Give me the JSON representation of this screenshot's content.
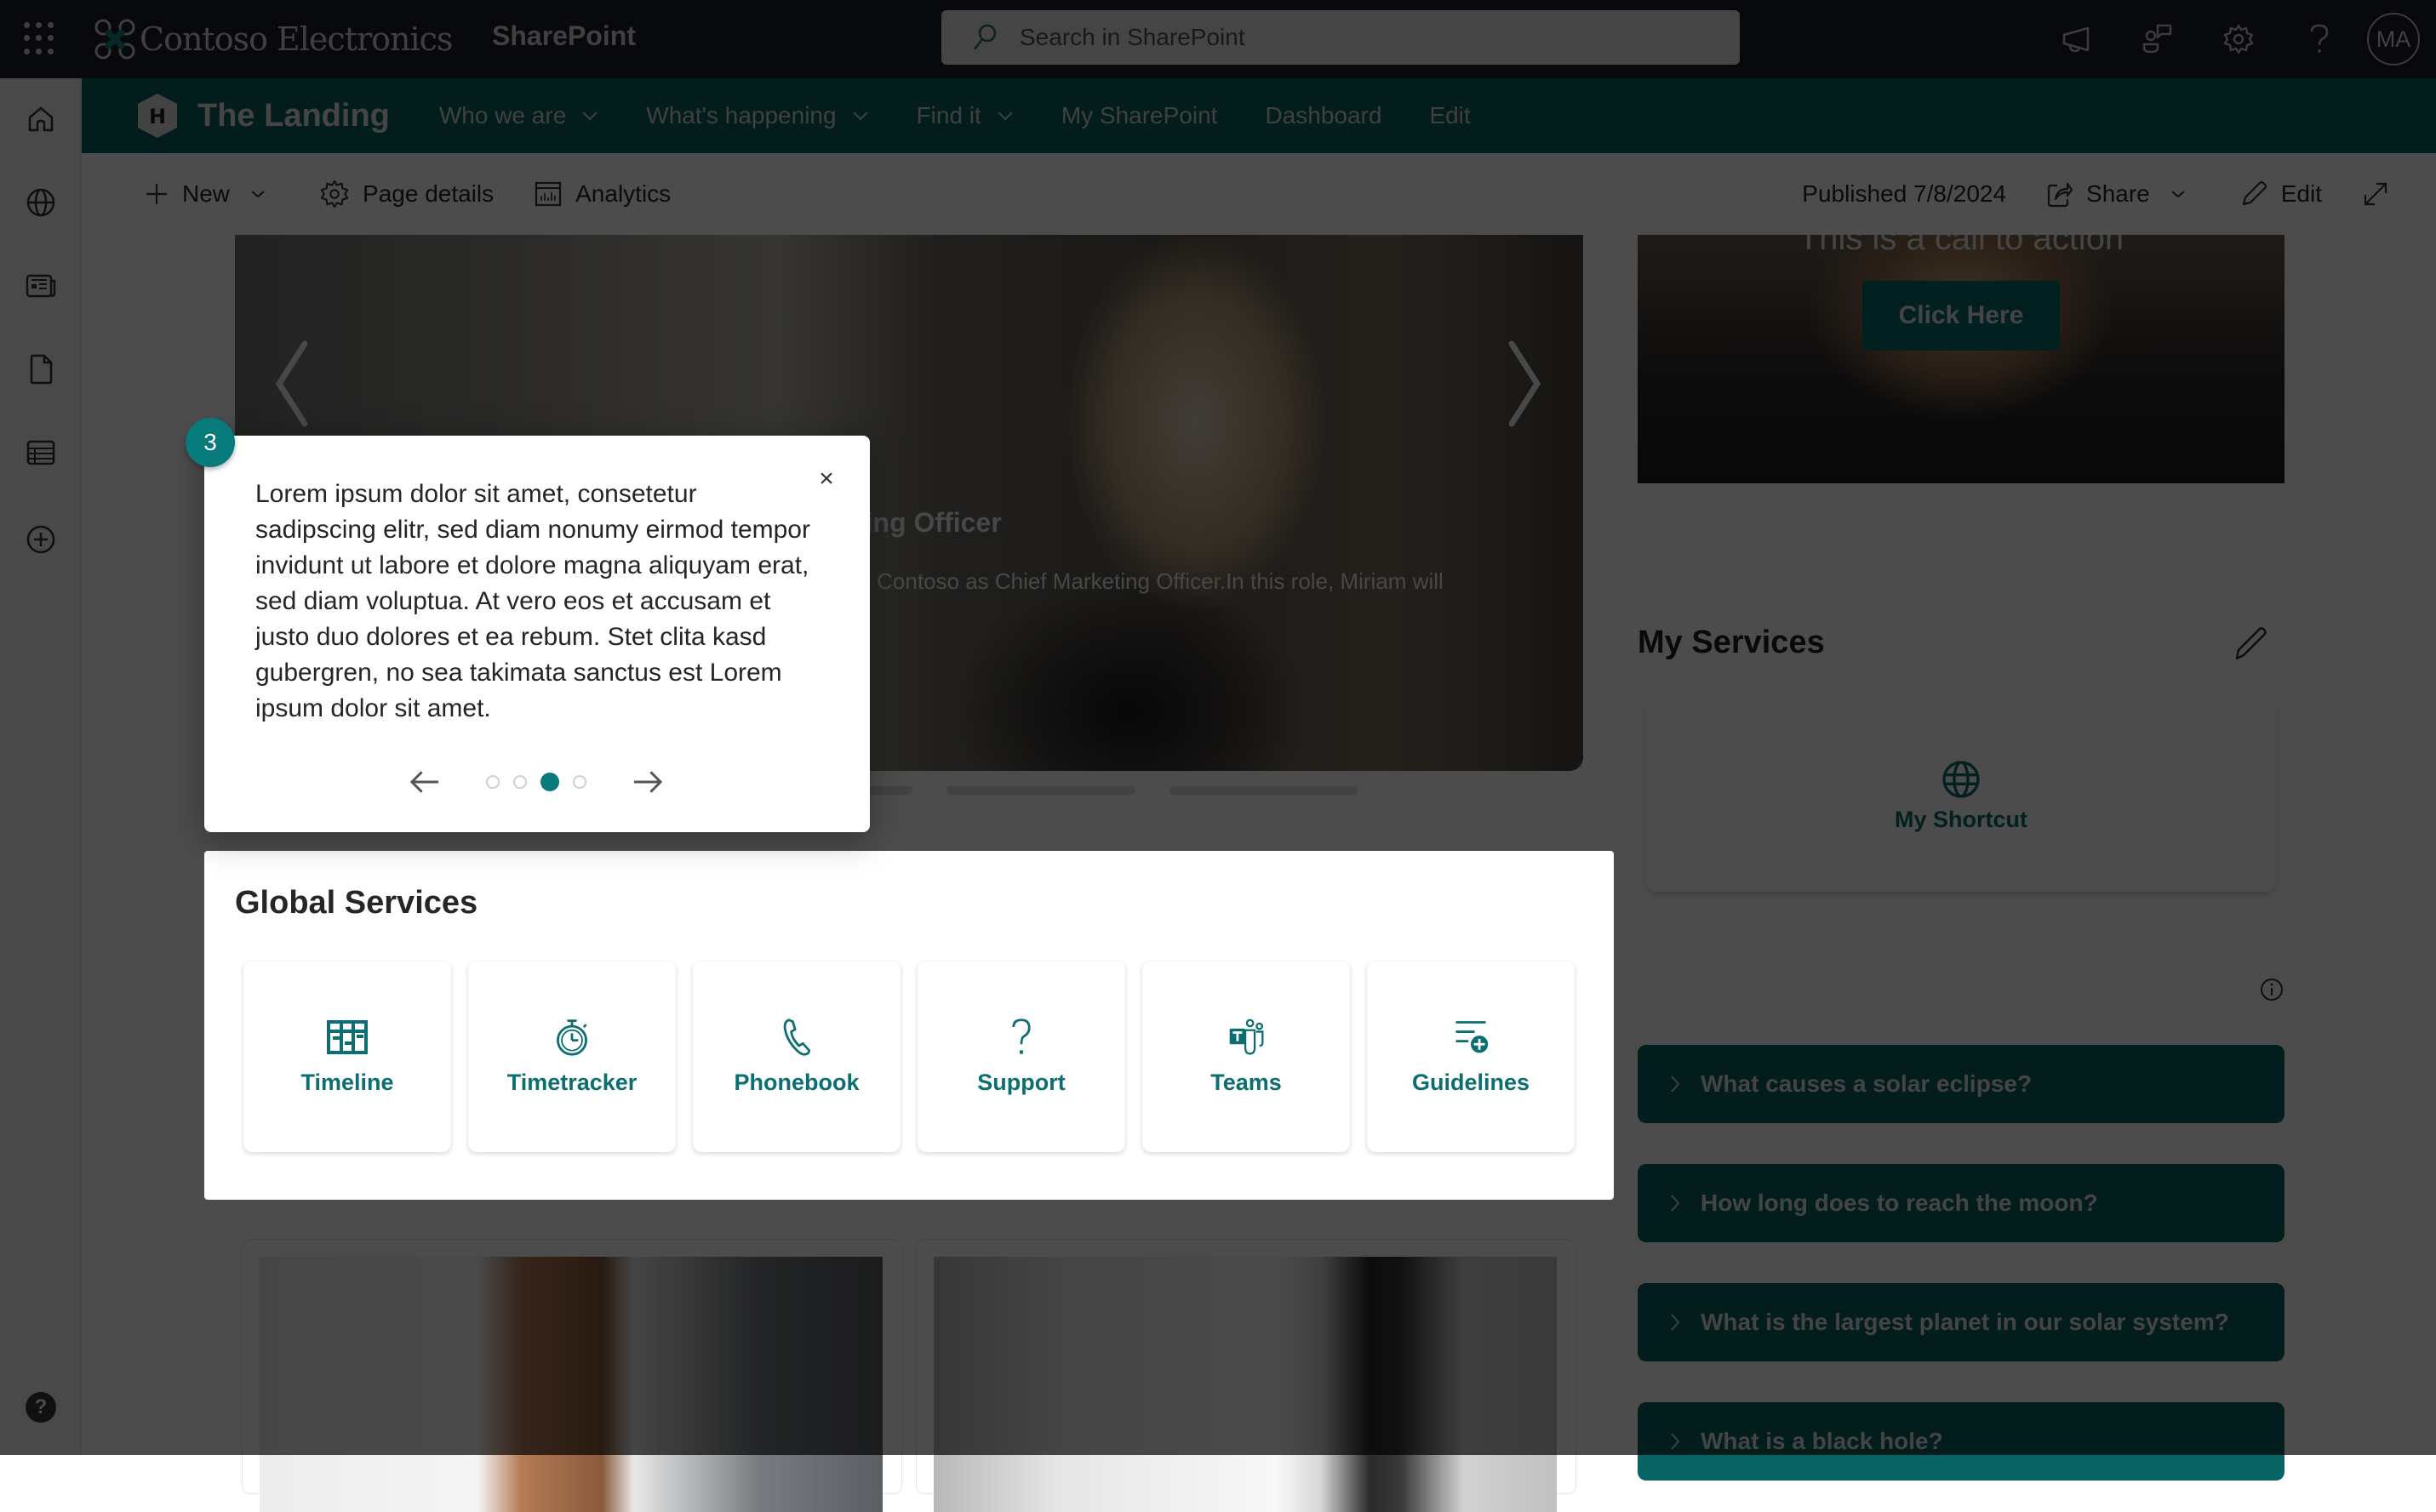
{
  "suitebar": {
    "brand": "Contoso Electronics",
    "app_name": "SharePoint",
    "search_placeholder": "Search in SharePoint",
    "icons": [
      "megaphone-icon",
      "feedback-icon",
      "settings-icon",
      "help-icon"
    ],
    "avatar_initials": "MA"
  },
  "leftrail": {
    "items": [
      "home-icon",
      "globe-icon",
      "news-icon",
      "document-icon",
      "list-icon",
      "add-icon"
    ],
    "help_label": "?"
  },
  "hubnav": {
    "site_logo_letter": "H",
    "site_title": "The Landing",
    "items": [
      {
        "label": "Who we are",
        "has_dropdown": true
      },
      {
        "label": "What's happening",
        "has_dropdown": true
      },
      {
        "label": "Find it",
        "has_dropdown": true
      },
      {
        "label": "My SharePoint",
        "has_dropdown": false
      },
      {
        "label": "Dashboard",
        "has_dropdown": false
      },
      {
        "label": "Edit",
        "has_dropdown": false
      }
    ]
  },
  "commandbar": {
    "new_label": "New",
    "page_details_label": "Page details",
    "analytics_label": "Analytics",
    "published_label": "Published 7/8/2024",
    "share_label": "Share",
    "edit_label": "Edit"
  },
  "hero": {
    "title_visible": "ting Officer",
    "description_visible": "ng Contoso as Chief Marketing Officer.In this role, Miriam will",
    "slide_count": 4,
    "active_slide": 1
  },
  "cta": {
    "text": "This is a call to action",
    "button_label": "Click Here"
  },
  "my_services": {
    "title": "My Services",
    "shortcut_label": "My Shortcut"
  },
  "faq": [
    {
      "question": "What causes a solar eclipse?"
    },
    {
      "question": "How long does to reach the moon?"
    },
    {
      "question": "What is the largest planet in our solar system?"
    },
    {
      "question": "What is a black hole?"
    }
  ],
  "global_services": {
    "title": "Global Services",
    "tiles": [
      {
        "label": "Timeline",
        "icon": "timeline-icon"
      },
      {
        "label": "Timetracker",
        "icon": "stopwatch-icon"
      },
      {
        "label": "Phonebook",
        "icon": "phone-icon"
      },
      {
        "label": "Support",
        "icon": "question-icon"
      },
      {
        "label": "Teams",
        "icon": "teams-icon"
      },
      {
        "label": "Guidelines",
        "icon": "guidelines-icon"
      }
    ]
  },
  "coachmark": {
    "step_number": "3",
    "body": "Lorem ipsum dolor sit amet, consetetur sadipscing elitr, sed diam nonumy eirmod tempor invidunt ut labore et dolore magna aliquyam erat, sed diam voluptua. At vero eos et accusam et justo duo dolores et ea rebum. Stet clita kasd gubergren, no sea takimata sanctus est Lorem ipsum dolor sit amet.",
    "close_label": "×",
    "total_steps": 4,
    "current_step": 3
  },
  "colors": {
    "accent": "#077a7c",
    "hub_nav": "#0a6060",
    "suite_bar": "#1b2029"
  }
}
